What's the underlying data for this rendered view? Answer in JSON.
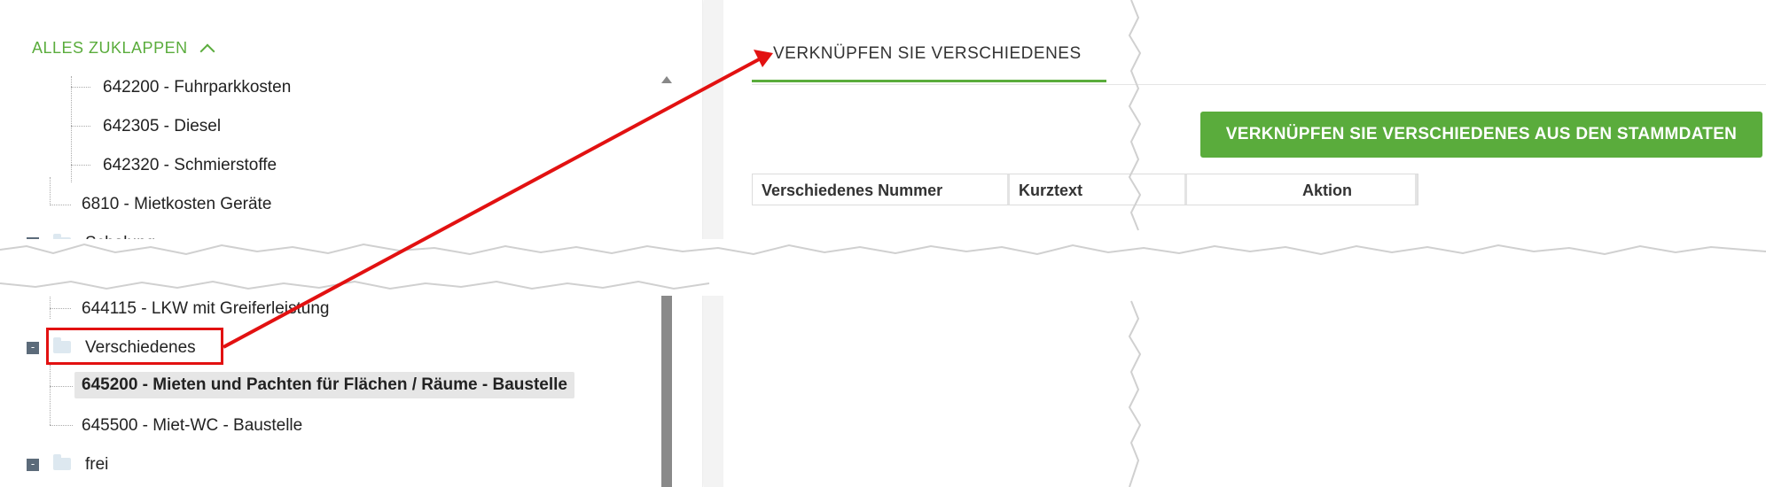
{
  "left_panel": {
    "collapse_all_label": "ALLES ZUKLAPPEN",
    "tree": {
      "item_642200": "642200 - Fuhrparkkosten",
      "item_642305": "642305 - Diesel",
      "item_642320": "642320 - Schmierstoffe",
      "item_6810": "6810 - Mietkosten Geräte",
      "folder_schalung": "Schalung",
      "item_644115": "644115 - LKW mit Greiferleistung",
      "folder_verschiedenes": "Verschiedenes",
      "item_645200": "645200 - Mieten und Pachten für Flächen / Räume - Baustelle",
      "item_645500": "645500 - Miet-WC - Baustelle",
      "folder_frei": "frei",
      "toggle_symbol": "-"
    }
  },
  "right_panel": {
    "tab_label": "VERKNÜPFEN SIE VERSCHIEDENES",
    "link_button_label": "VERKNÜPFEN SIE VERSCHIEDENES AUS DEN STAMMDATEN",
    "columns": [
      "Verschiedenes Nummer",
      "Kurztext",
      "Aktion"
    ]
  },
  "colors": {
    "accent_green": "#5aac3c",
    "annotation_red": "#e21111",
    "selected_bg": "#e6e6e6"
  },
  "icons": [
    "chevron-up-icon",
    "folder-icon",
    "collapse-toggle-icon",
    "annotation-arrow"
  ]
}
